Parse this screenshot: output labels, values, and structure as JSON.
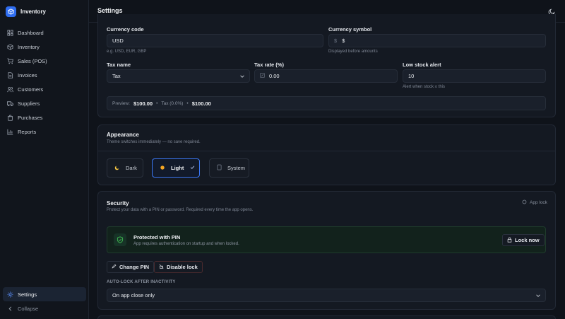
{
  "app": {
    "name": "Inventory"
  },
  "sidebar": {
    "items": [
      {
        "label": "Dashboard",
        "icon": "dashboard-icon"
      },
      {
        "label": "Inventory",
        "icon": "box-icon"
      },
      {
        "label": "Sales (POS)",
        "icon": "cart-icon"
      },
      {
        "label": "Invoices",
        "icon": "document-icon"
      },
      {
        "label": "Customers",
        "icon": "users-icon"
      },
      {
        "label": "Suppliers",
        "icon": "truck-icon"
      },
      {
        "label": "Purchases",
        "icon": "bag-icon"
      },
      {
        "label": "Reports",
        "icon": "chart-icon"
      }
    ],
    "settings": "Settings",
    "collapse": "Collapse"
  },
  "header": {
    "title": "Settings"
  },
  "general": {
    "currency_code_label": "Currency code",
    "currency_code_value": "USD",
    "currency_code_hint": "e.g. USD, EUR, GBP",
    "currency_symbol_label": "Currency symbol",
    "currency_symbol_prefix": "$",
    "currency_symbol_value": "$",
    "currency_symbol_hint": "Displayed before amounts",
    "tax_name_label": "Tax name",
    "tax_name_value": "Tax",
    "tax_rate_label": "Tax rate (%)",
    "tax_rate_value": "0.00",
    "low_stock_label": "Low stock alert",
    "low_stock_value": "10",
    "low_stock_hint": "Alert when stock ≤ this",
    "preview_label": "Preview:",
    "preview_amount": "$100.00",
    "preview_tax": "Tax (0.0%)",
    "preview_total": "$100.00"
  },
  "appearance": {
    "title": "Appearance",
    "subtitle": "Theme switches immediately — no save required.",
    "options": [
      "Dark",
      "Light",
      "System"
    ],
    "selected": "Light"
  },
  "security": {
    "title": "Security",
    "subtitle": "Protect your data with a PIN or password. Required every time the app opens.",
    "app_lock": "App lock",
    "status_title": "Protected with PIN",
    "status_sub": "App requires authentication on startup and when locked.",
    "lock_now": "Lock now",
    "change_pin": "Change PIN",
    "disable_lock": "Disable lock",
    "autolock_label": "AUTO-LOCK AFTER INACTIVITY",
    "autolock_value": "On app close only"
  },
  "colors": {
    "accent": "#3b78f5",
    "success": "#3fb950",
    "danger": "#e5534b"
  }
}
